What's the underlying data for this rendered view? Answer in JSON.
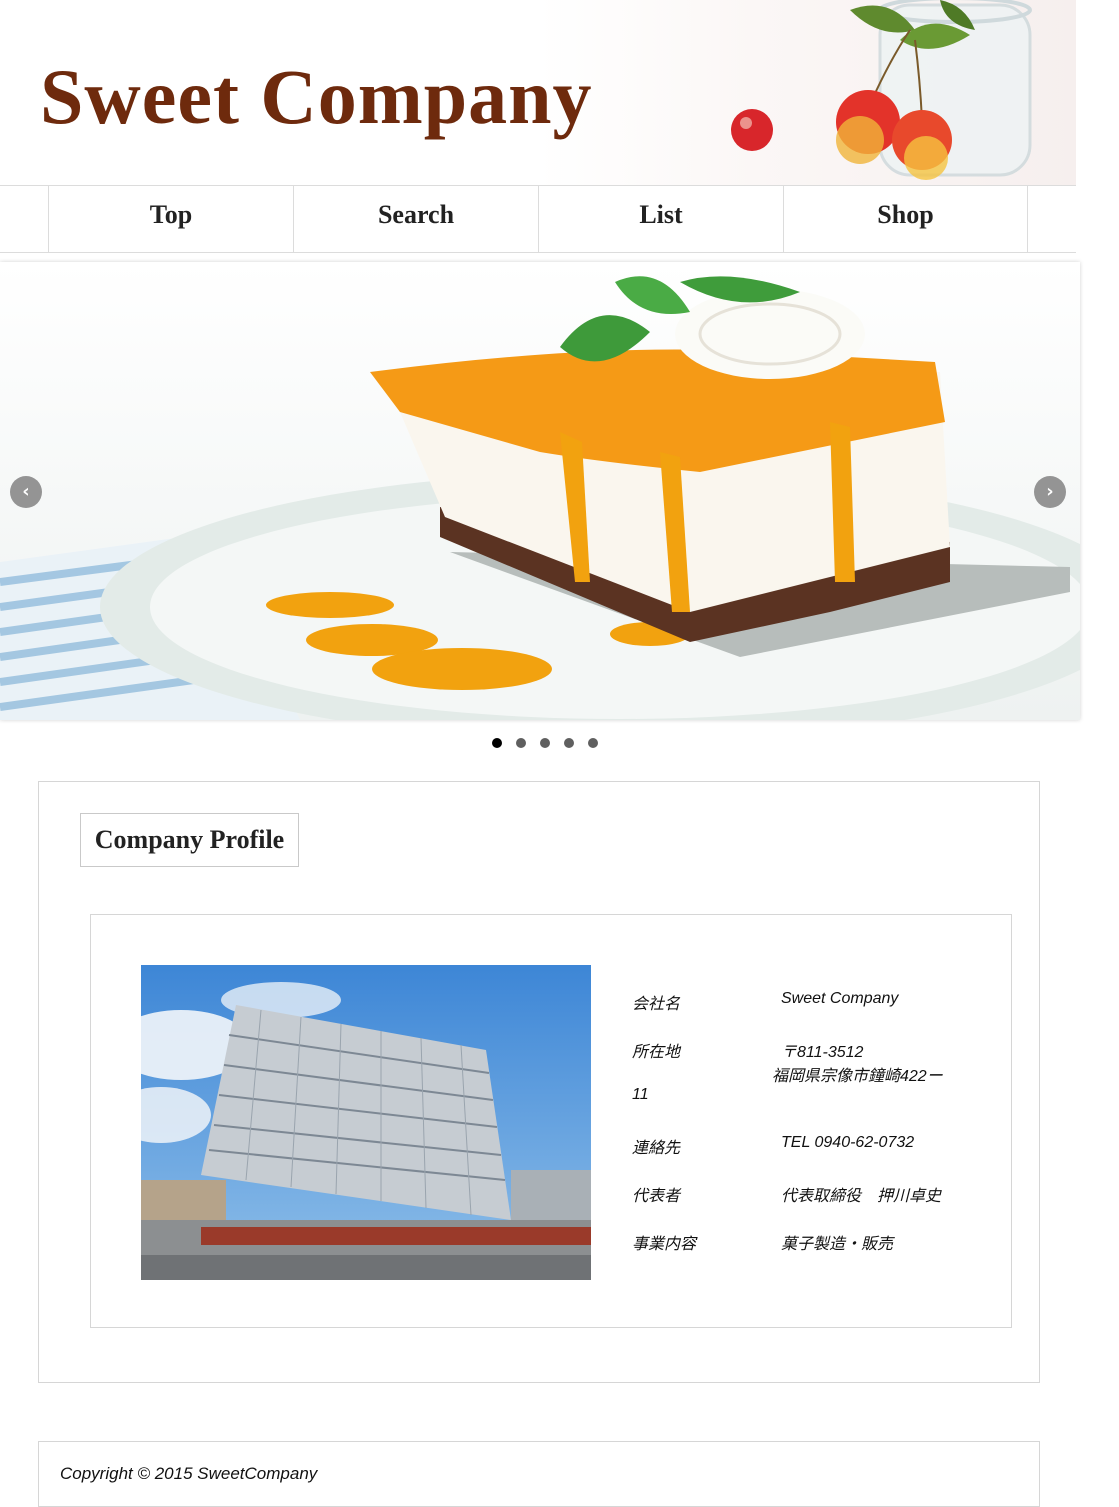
{
  "header": {
    "site_title": "Sweet Company"
  },
  "nav": {
    "items": [
      {
        "label": "Top"
      },
      {
        "label": "Search"
      },
      {
        "label": "List"
      },
      {
        "label": "Shop"
      }
    ]
  },
  "slider": {
    "prev_glyph": "‹",
    "next_glyph": "›",
    "slide_count": 5,
    "active_slide": 1
  },
  "profile": {
    "title": "Company Profile",
    "rows": [
      {
        "label": "会社名",
        "value": "Sweet Company"
      },
      {
        "label": "所在地",
        "value": "〒811-3512",
        "value2": "福岡県宗像市鐘崎422ー",
        "value3": "11"
      },
      {
        "label": "連絡先",
        "value": "TEL 0940-62-0732"
      },
      {
        "label": "代表者",
        "value": "代表取締役　押川卓史"
      },
      {
        "label": "事業内容",
        "value": "菓子製造・販売"
      }
    ]
  },
  "footer": {
    "copyright": "Copyright © 2015 SweetCompany"
  },
  "colors": {
    "brand": "#6e2a0d",
    "border": "#d6d6d6",
    "text": "#111111"
  },
  "icons": {
    "prev": "chevron-left-icon",
    "next": "chevron-right-icon"
  }
}
